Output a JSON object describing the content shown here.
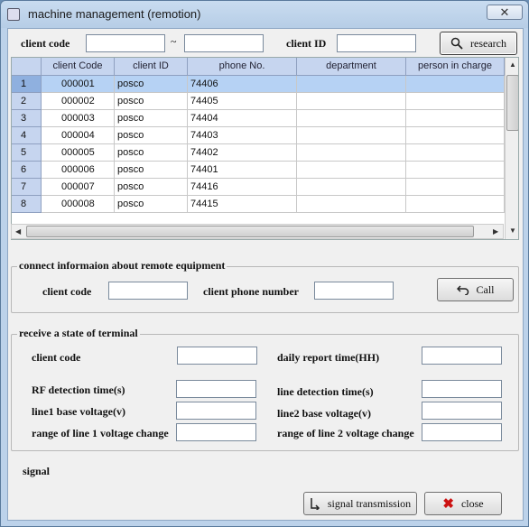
{
  "window": {
    "title": "machine management (remotion)",
    "close_glyph": "✕"
  },
  "search": {
    "client_code_label": "client code",
    "client_code_from": "",
    "range_separator": "~",
    "client_code_to": "",
    "client_id_label": "client ID",
    "client_id_value": "",
    "research_button": "research"
  },
  "grid": {
    "columns": [
      "client Code",
      "client ID",
      "phone No.",
      "department",
      "person in charge"
    ],
    "rows": [
      {
        "num": "1",
        "client_code": "000001",
        "client_id": "posco",
        "phone": "74406",
        "department": "",
        "person": ""
      },
      {
        "num": "2",
        "client_code": "000002",
        "client_id": "posco",
        "phone": "74405",
        "department": "",
        "person": ""
      },
      {
        "num": "3",
        "client_code": "000003",
        "client_id": "posco",
        "phone": "74404",
        "department": "",
        "person": ""
      },
      {
        "num": "4",
        "client_code": "000004",
        "client_id": "posco",
        "phone": "74403",
        "department": "",
        "person": ""
      },
      {
        "num": "5",
        "client_code": "000005",
        "client_id": "posco",
        "phone": "74402",
        "department": "",
        "person": ""
      },
      {
        "num": "6",
        "client_code": "000006",
        "client_id": "posco",
        "phone": "74401",
        "department": "",
        "person": ""
      },
      {
        "num": "7",
        "client_code": "000007",
        "client_id": "posco",
        "phone": "74416",
        "department": "",
        "person": ""
      },
      {
        "num": "8",
        "client_code": "000008",
        "client_id": "posco",
        "phone": "74415",
        "department": "",
        "person": ""
      }
    ]
  },
  "connect": {
    "title": "connect informaion about remote equipment",
    "client_code_label": "client code",
    "client_code_value": "",
    "client_phone_label": "client phone number",
    "client_phone_value": "",
    "call_button": "Call"
  },
  "terminal": {
    "title": "receive a state of terminal",
    "client_code_label": "client code",
    "daily_report_label": "daily report time(HH)",
    "rf_detection_label": "RF detection time(s)",
    "line_detection_label": "line detection time(s)",
    "line1_voltage_label": "line1 base voltage(v)",
    "line2_voltage_label": "line2 base voltage(v)",
    "line1_range_label": "range of line 1 voltage change",
    "line2_range_label": "range of line 2 voltage change"
  },
  "footer": {
    "signal_label": "signal",
    "signal_transmission_button": "signal transmission",
    "close_button": "close"
  },
  "colors": {
    "grid_header": "#c6d5ef",
    "selected_row": "#b6d2f4",
    "close_icon": "#cc1111"
  }
}
